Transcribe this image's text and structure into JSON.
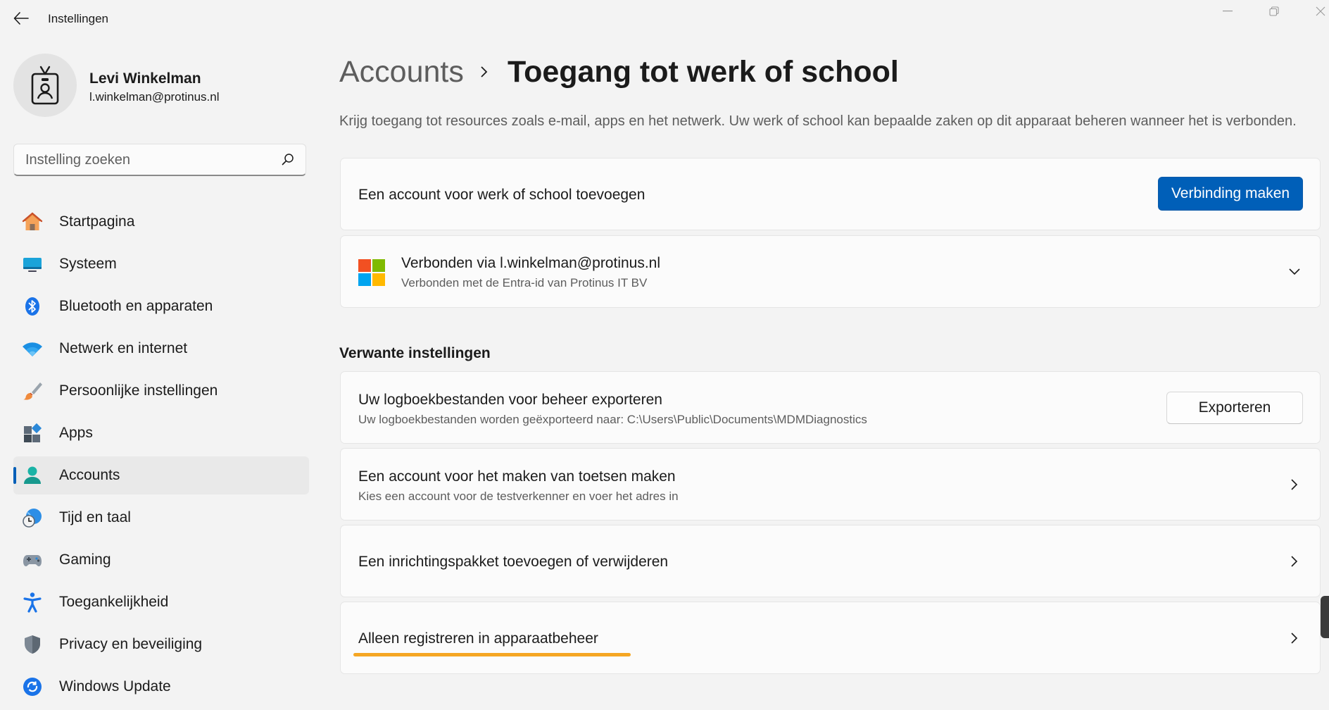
{
  "window": {
    "title": "Instellingen"
  },
  "profile": {
    "name": "Levi Winkelman",
    "email": "l.winkelman@protinus.nl"
  },
  "search": {
    "placeholder": "Instelling zoeken"
  },
  "sidebar": {
    "items": [
      {
        "label": "Startpagina",
        "icon": "home-icon"
      },
      {
        "label": "Systeem",
        "icon": "system-icon"
      },
      {
        "label": "Bluetooth en apparaten",
        "icon": "bluetooth-icon"
      },
      {
        "label": "Netwerk en internet",
        "icon": "wifi-icon"
      },
      {
        "label": "Persoonlijke instellingen",
        "icon": "brush-icon"
      },
      {
        "label": "Apps",
        "icon": "apps-icon"
      },
      {
        "label": "Accounts",
        "icon": "accounts-icon",
        "active": true
      },
      {
        "label": "Tijd en taal",
        "icon": "clock-globe-icon"
      },
      {
        "label": "Gaming",
        "icon": "gamepad-icon"
      },
      {
        "label": "Toegankelijkheid",
        "icon": "accessibility-icon"
      },
      {
        "label": "Privacy en beveiliging",
        "icon": "shield-icon"
      },
      {
        "label": "Windows Update",
        "icon": "windows-update-icon"
      }
    ]
  },
  "breadcrumb": {
    "parent": "Accounts",
    "current": "Toegang tot werk of school"
  },
  "description": "Krijg toegang tot resources zoals e-mail, apps en het netwerk. Uw werk of school kan bepaalde zaken op dit apparaat beheren wanneer het is verbonden.",
  "add_account": {
    "title": "Een account voor werk of school toevoegen",
    "button": "Verbinding maken"
  },
  "connected": {
    "title": "Verbonden via l.winkelman@protinus.nl",
    "subtitle": "Verbonden met de Entra-id van Protinus IT BV"
  },
  "related": {
    "title": "Verwante instellingen",
    "export": {
      "title": "Uw logboekbestanden voor beheer exporteren",
      "subtitle": "Uw logboekbestanden worden geëxporteerd naar: C:\\Users\\Public\\Documents\\MDMDiagnostics",
      "button": "Exporteren"
    },
    "test_account": {
      "title": "Een account voor het maken van toetsen maken",
      "subtitle": "Kies een account voor de testverkenner en voer het adres in"
    },
    "provisioning": {
      "title": "Een inrichtingspakket toevoegen of verwijderen"
    },
    "mdm_only": {
      "title": "Alleen registreren in apparaatbeheer"
    }
  },
  "colors": {
    "accent": "#005fb8",
    "highlight": "#f5a623",
    "background": "#f3f3f3",
    "card": "#fbfbfb"
  }
}
